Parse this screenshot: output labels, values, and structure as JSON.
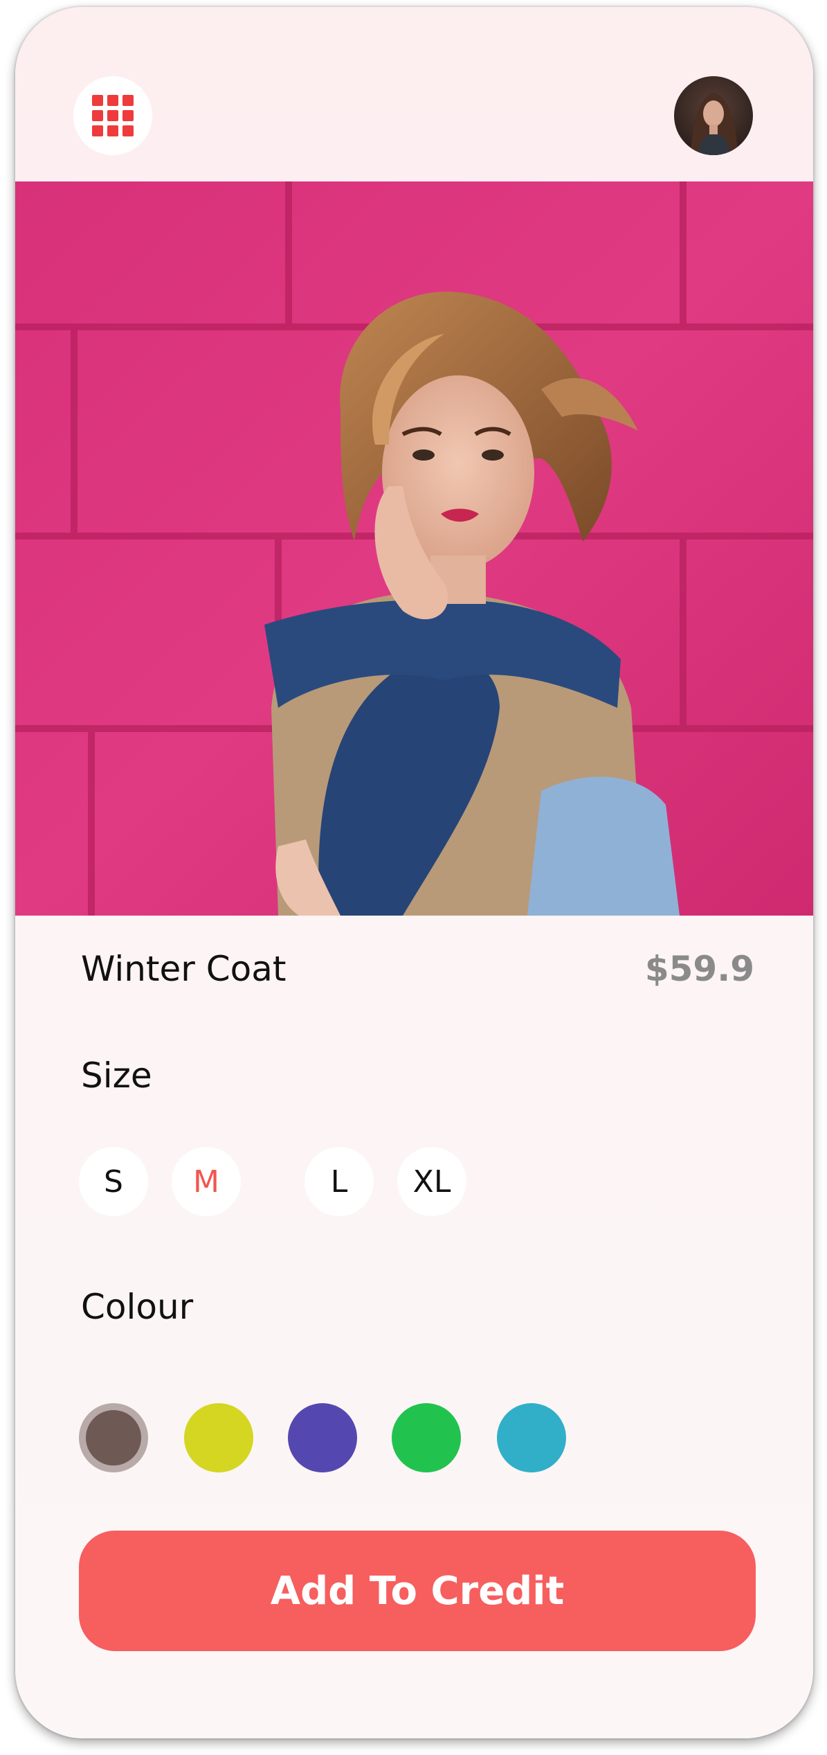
{
  "header": {
    "menu_icon": "grid-menu-icon",
    "avatar_icon": "user-avatar"
  },
  "product": {
    "name": "Winter Coat",
    "price": "$59.9",
    "image": "fashion-model-photo"
  },
  "size_section": {
    "label": "Size",
    "options": [
      "S",
      "M",
      "L",
      "XL"
    ],
    "selected": "M"
  },
  "colour_section": {
    "label": "Colour",
    "swatches": [
      "#6e5954",
      "#d4d622",
      "#5448b0",
      "#22c24e",
      "#31afc9"
    ],
    "selected_index": 0
  },
  "cta": {
    "label": "Add To Credit"
  },
  "colors": {
    "accent": "#f75e5e",
    "menu_icon": "#ef3b3b",
    "price_text": "#8a8a8a",
    "selected_size": "#f2554f"
  }
}
